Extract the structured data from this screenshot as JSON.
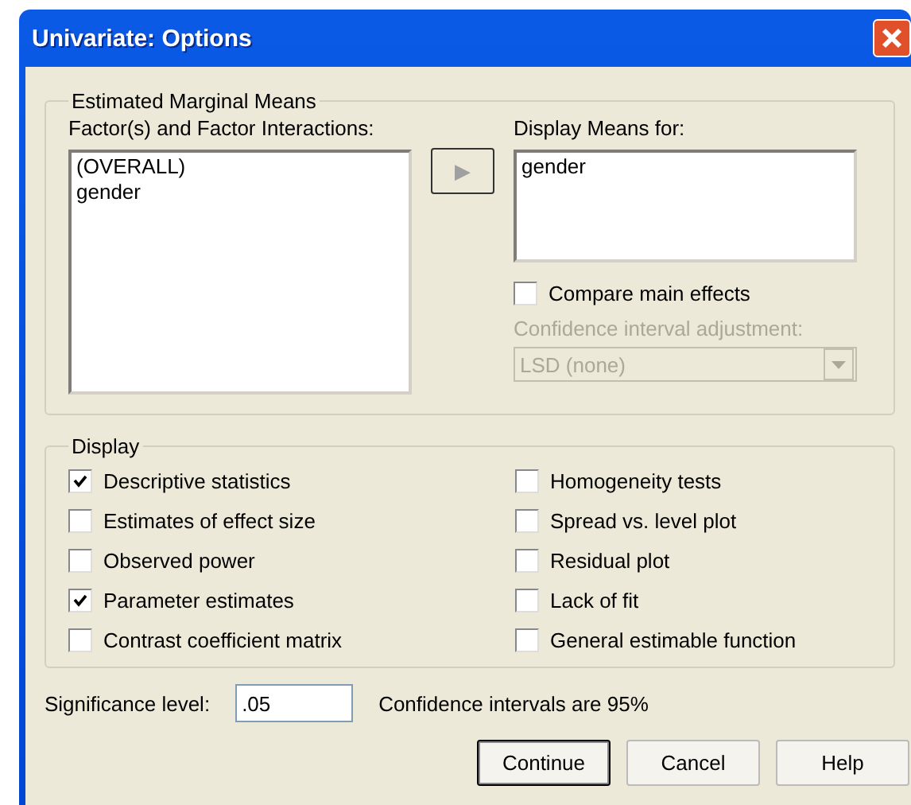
{
  "window": {
    "title": "Univariate: Options"
  },
  "marginal_means": {
    "title": "Estimated Marginal Means",
    "factors": {
      "label": "Factor(s) and Factor Interactions:",
      "items": [
        "(OVERALL)",
        "gender"
      ]
    },
    "move_button": {
      "glyph": "▶",
      "disabled": true
    },
    "display_means": {
      "label": "Display Means for:",
      "items": [
        "gender"
      ]
    },
    "compare_main_effects": {
      "label": "Compare main effects",
      "checked": false
    },
    "ci_adjustment": {
      "label": "Confidence interval adjustment:",
      "value": "LSD (none)",
      "disabled": true
    }
  },
  "display": {
    "title": "Display",
    "options": [
      {
        "label": "Descriptive statistics",
        "checked": true
      },
      {
        "label": "Homogeneity tests",
        "checked": false
      },
      {
        "label": "Estimates of effect size",
        "checked": false
      },
      {
        "label": "Spread vs. level plot",
        "checked": false
      },
      {
        "label": "Observed power",
        "checked": false
      },
      {
        "label": "Residual plot",
        "checked": false
      },
      {
        "label": "Parameter estimates",
        "checked": true
      },
      {
        "label": "Lack of fit",
        "checked": false
      },
      {
        "label": "Contrast coefficient matrix",
        "checked": false
      },
      {
        "label": "General estimable function",
        "checked": false
      }
    ]
  },
  "significance": {
    "label": "Significance level:",
    "value": ".05",
    "note": "Confidence intervals are 95%"
  },
  "buttons": [
    {
      "label": "Continue",
      "default": true
    },
    {
      "label": "Cancel",
      "default": false
    },
    {
      "label": "Help",
      "default": false
    }
  ]
}
